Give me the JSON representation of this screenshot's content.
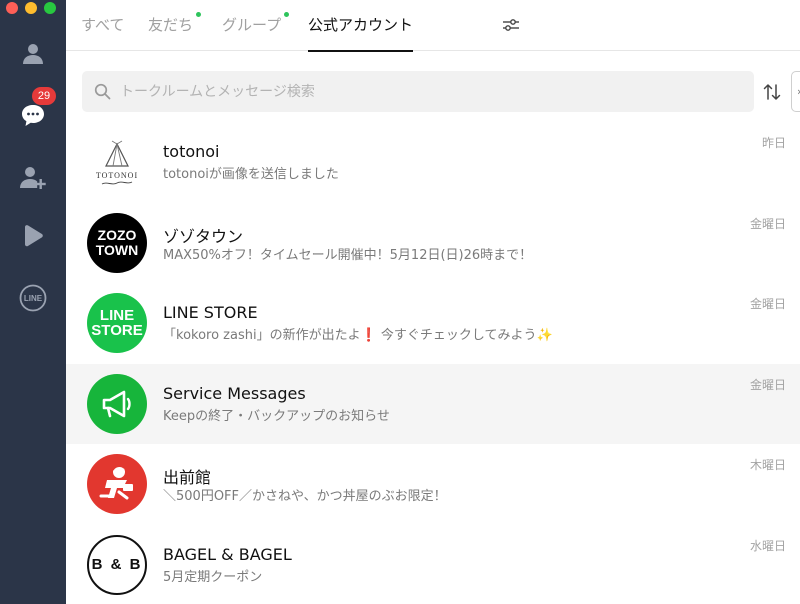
{
  "sidebar": {
    "unread_badge": "29",
    "line_icon_text": "LINE"
  },
  "tabs": [
    {
      "label": "すべて",
      "active": false,
      "dot": false
    },
    {
      "label": "友だち",
      "active": false,
      "dot": true
    },
    {
      "label": "グループ",
      "active": false,
      "dot": true
    },
    {
      "label": "公式アカウント",
      "active": true,
      "dot": false
    }
  ],
  "search": {
    "placeholder": "トークルームとメッセージ検索",
    "value": ""
  },
  "chats": [
    {
      "name": "totonoi",
      "preview": "totonoiが画像を送信しました",
      "date": "昨日",
      "avatar_text": "TOTONOI"
    },
    {
      "name": "ゾゾタウン",
      "preview": "MAX50%オフ！タイムセール開催中！5月12日(日)26時まで！",
      "date": "金曜日",
      "avatar_line1": "ZOZO",
      "avatar_line2": "TOWN"
    },
    {
      "name": "LINE STORE",
      "preview": "「kokoro zashi」の新作が出たよ❗️ 今すぐチェックしてみよう✨",
      "date": "金曜日",
      "avatar_line1": "LINE",
      "avatar_line2": "STORE"
    },
    {
      "name": "Service Messages",
      "preview": "Keepの終了・バックアップのお知らせ",
      "date": "金曜日",
      "selected": true
    },
    {
      "name": "出前館",
      "preview": "＼500円OFF／かさねや、かつ丼屋のぶお限定！",
      "date": "木曜日"
    },
    {
      "name": "BAGEL & BAGEL",
      "preview": "5月定期クーポン",
      "date": "水曜日",
      "avatar_text": "B & B"
    }
  ],
  "colors": {
    "sidebar_bg": "#2b3548",
    "accent_green": "#2ec45c",
    "badge_red": "#e63a3a"
  }
}
